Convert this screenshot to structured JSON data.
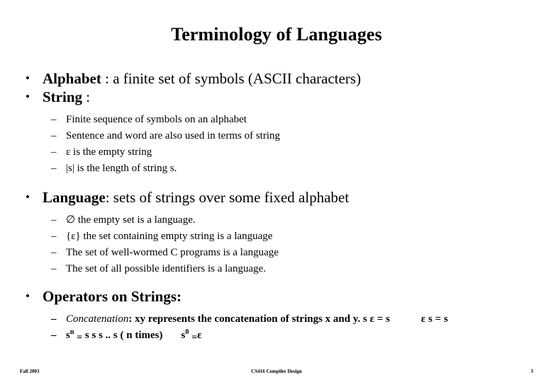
{
  "slide": {
    "title": "Terminology of Languages",
    "page_number": "3",
    "background_color": "#ffffff",
    "text_color": "#000000"
  },
  "bullets": {
    "bullet_glyph": "•",
    "dash_glyph": "–",
    "alphabet": {
      "term": "Alphabet",
      "rest": " : a finite set of symbols  (ASCII characters)"
    },
    "string": {
      "term": "String",
      "rest": " :"
    },
    "string_sub": [
      "Finite sequence of symbols on an alphabet",
      "Sentence and word are also used in terms of string",
      "ε  is the empty string",
      "|s| is the length of string s."
    ],
    "language": {
      "term": "Language",
      "rest": ": sets of strings over some fixed alphabet"
    },
    "language_sub": [
      "∅ the empty set is a language.",
      "{ε} the set containing empty string is a language",
      "The set of well-wormed C programs is a language",
      "The set of all possible identifiers is a language."
    ],
    "operators": {
      "term": "Operators on Strings:"
    },
    "concatenation": {
      "label": "Concatenation",
      "colon": ":  ",
      "text": "xy represents the concatenation of strings x and y.  ",
      "identity_1": "s ε = s",
      "identity_2": "ε s = s"
    },
    "power": {
      "base": "s",
      "exponent_n": "n",
      "equals": "=",
      "expansion": " s s s .. s ( n times)",
      "base_zero": "s",
      "exponent_zero": "0",
      "equals_zero": "=",
      "epsilon": "ε"
    }
  },
  "footer": {
    "left": "Fall 2003",
    "center": "CS416 Compiler Design",
    "right": "3"
  }
}
